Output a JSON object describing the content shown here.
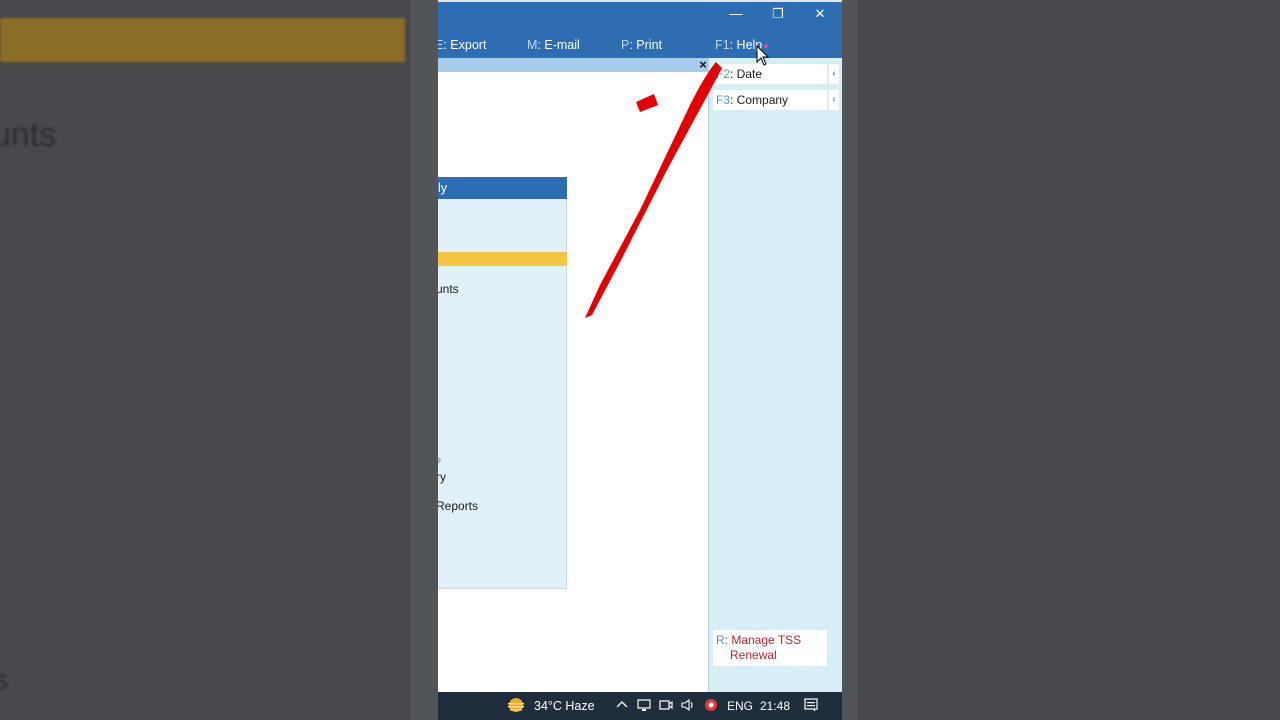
{
  "background": {
    "left_heading_fragment": "unts",
    "left_bottom_fragment": "s"
  },
  "window": {
    "controls": {
      "minimize": "—",
      "restore": "❐",
      "close": "✕"
    },
    "menu": [
      {
        "key": "E",
        "label": ": Export"
      },
      {
        "key": "M",
        "label": ": E-mail"
      },
      {
        "key": "P",
        "label": ": Print"
      },
      {
        "key": "F1",
        "label": ": Help"
      }
    ],
    "close_panel": "×"
  },
  "panel": {
    "title": "ly",
    "items": [
      {
        "label": "unts"
      },
      {
        "label": "e"
      },
      {
        "label": "ry"
      },
      {
        "label": "Reports"
      }
    ]
  },
  "sidebar": {
    "date": {
      "key": "F2",
      "label": ": Date"
    },
    "company": {
      "key": "F3",
      "label": ": Company"
    },
    "tss": {
      "key": "R",
      "label": ": Manage TSS",
      "label2": "Renewal"
    },
    "arrow": "‹"
  },
  "taskbar": {
    "weather": "34°C  Haze",
    "language": "ENG",
    "time": "21:48"
  },
  "colors": {
    "titlebar": "#2f6db3",
    "sidebar": "#d8eef7",
    "highlight": "#f4c542",
    "annotation": "#e00000"
  }
}
